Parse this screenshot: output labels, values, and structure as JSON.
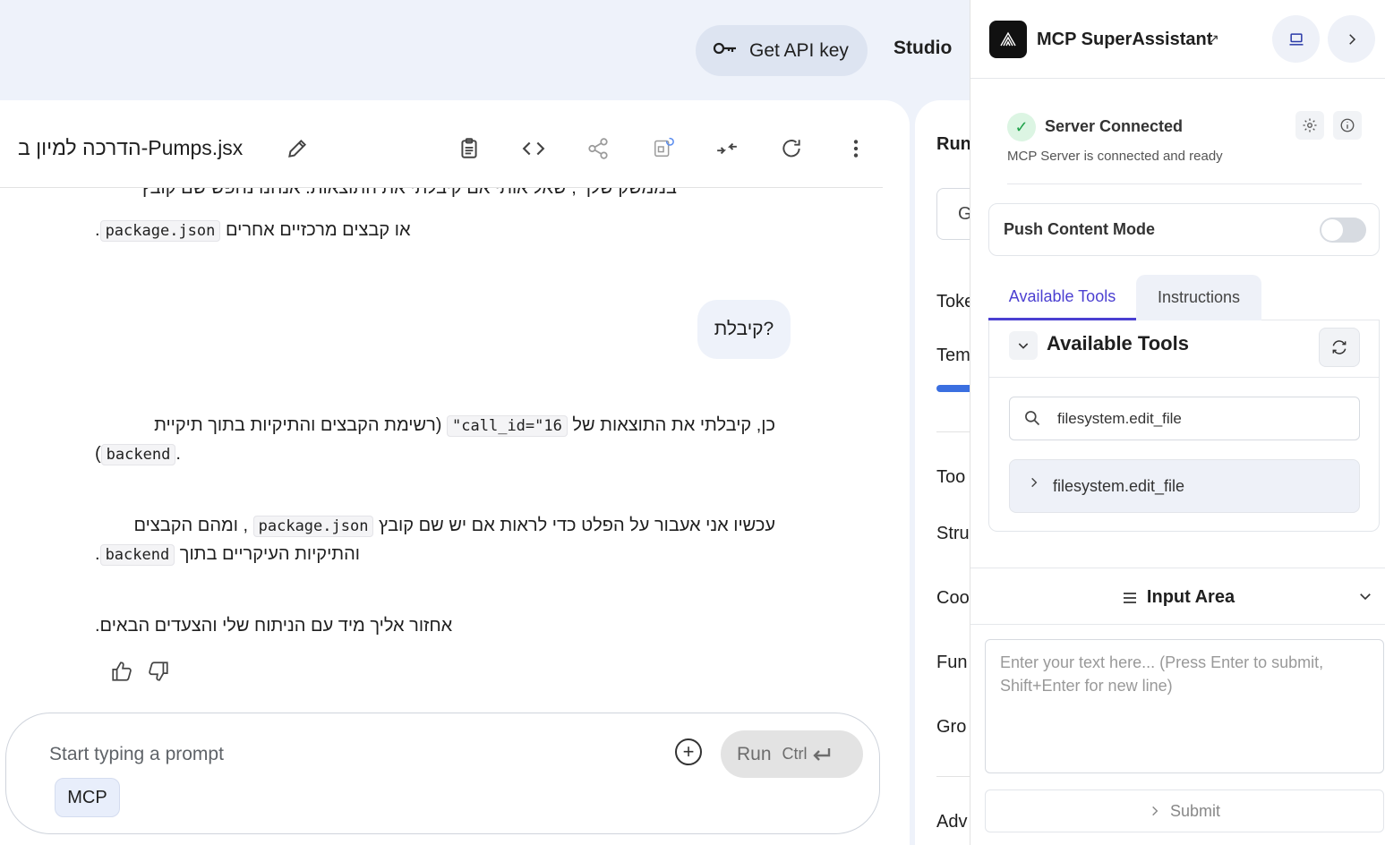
{
  "topbar": {
    "api_key_label": "Get API key",
    "studio_label": "Studio"
  },
  "chat": {
    "title": "הדרכה למיון ב-Pumps.jsx",
    "messages": {
      "m1_cut": "בממשק שלך , שאל אותי אם קיבלתי את התוצאות. אנחנו נחפש שם קובץ",
      "m1_pre": "או קבצים מרכזיים אחרים",
      "m1_code": "package.json",
      "user_bubble": "קיבלת?",
      "m2_pre": "כן, קיבלתי את התוצאות של",
      "m2_code": "call_id=\"16\"",
      "m2_post": "(רשימת הקבצים והתיקיות בתוך תיקיית",
      "m2_line2_code": "backend",
      "m3_pre": "עכשיו אני אעבור על הפלט כדי לראות אם יש שם קובץ",
      "m3_code": "package.json",
      "m3_post": ", ומהם הקבצים",
      "m3_line2_pre": "והתיקיות העיקריים בתוך",
      "m3_line2_code": "backend",
      "m4": "אחזור אליך מיד עם הניתוח שלי והצעדים הבאים."
    },
    "prompt": {
      "placeholder": "Start typing a prompt",
      "run_label": "Run",
      "run_shortcut": "Ctrl",
      "mcp_chip": "MCP"
    }
  },
  "settings_partial": {
    "labels": [
      "Run",
      "G",
      "Toke",
      "Tem",
      "Too",
      "Stru",
      "Coo",
      "Fun",
      "Gro",
      "Adv"
    ]
  },
  "mcp_panel": {
    "title": "MCP SuperAssistant",
    "status_title": "Server Connected",
    "status_sub": "MCP Server is connected and ready",
    "push_mode_label": "Push Content Mode",
    "push_mode_on": false,
    "tabs": [
      "Available Tools",
      "Instructions"
    ],
    "active_tab": "Available Tools",
    "tools_header": "Available Tools",
    "search_value": "filesystem.edit_file",
    "tool_items": [
      "filesystem.edit_file"
    ],
    "input_area_title": "Input Area",
    "input_placeholder": "Enter your text here... (Press Enter to submit, Shift+Enter for new line)",
    "submit_label": "Submit"
  },
  "colors": {
    "accent": "#4b3fd1",
    "success": "#1fa24a",
    "background": "#eef2fa"
  }
}
